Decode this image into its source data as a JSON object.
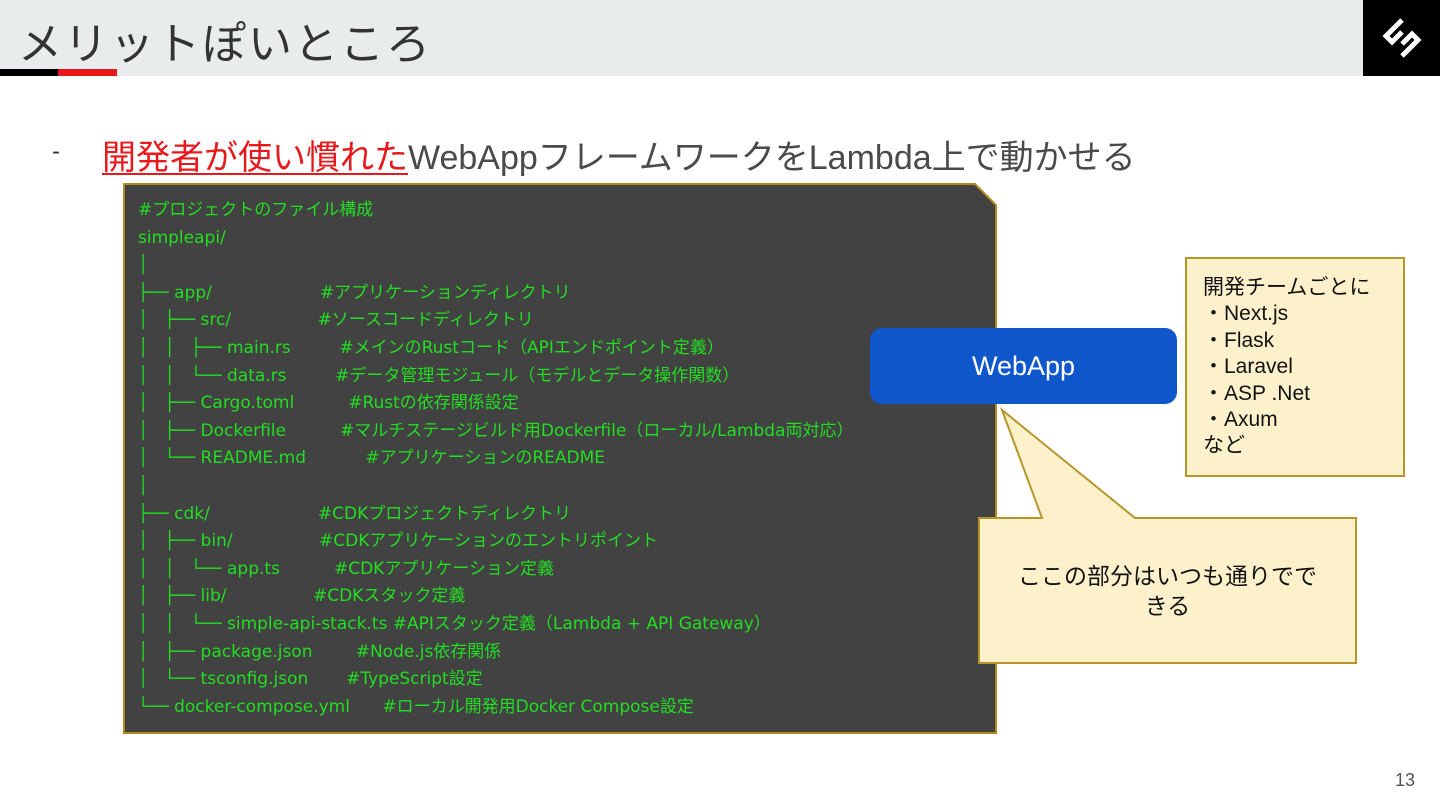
{
  "slide": {
    "title": "メリットぽいところ",
    "page_number": "13",
    "logo_icon": "brand-logo-icon"
  },
  "headline": {
    "dash": "-",
    "highlight": "開発者が使い慣れた",
    "rest": "WebAppフレームワークをLambda上で動かせる"
  },
  "code_block": {
    "lines": [
      "#プロジェクトのファイル構成",
      "simpleapi/",
      "│",
      "├── app/                    #アプリケーションディレクトリ",
      "│   ├── src/                #ソースコードディレクトリ",
      "│   │   ├── main.rs         #メインのRustコード（APIエンドポイント定義）",
      "│   │   └── data.rs         #データ管理モジュール（モデルとデータ操作関数）",
      "│   ├── Cargo.toml          #Rustの依存関係設定",
      "│   ├── Dockerfile          #マルチステージビルド用Dockerfile（ローカル/Lambda両対応）",
      "│   └── README.md           #アプリケーションのREADME",
      "│",
      "├── cdk/                    #CDKプロジェクトディレクトリ",
      "│   ├── bin/                #CDKアプリケーションのエントリポイント",
      "│   │   └── app.ts          #CDKアプリケーション定義",
      "│   ├── lib/                #CDKスタック定義",
      "│   │   └── simple-api-stack.ts #APIスタック定義（Lambda + API Gateway）",
      "│   ├── package.json        #Node.js依存関係",
      "│   └── tsconfig.json       #TypeScript設定",
      "└── docker-compose.yml      #ローカル開発用Docker Compose設定"
    ]
  },
  "webapp_button": {
    "label": "WebApp"
  },
  "callout": {
    "text_line1": "ここの部分はいつも通りでで",
    "text_line2": "きる"
  },
  "note": {
    "heading": "開発チームごとに",
    "items": [
      "・Next.js",
      "・Flask",
      "・Laravel",
      "・ASP .Net",
      "・Axum"
    ],
    "footer": "など"
  },
  "colors": {
    "accent_red": "#e8191c",
    "code_bg": "#424242",
    "code_text": "#22dd22",
    "button_blue": "#1157cc",
    "note_bg": "#fdf1cc",
    "callout_bg": "#fdf1cc"
  }
}
